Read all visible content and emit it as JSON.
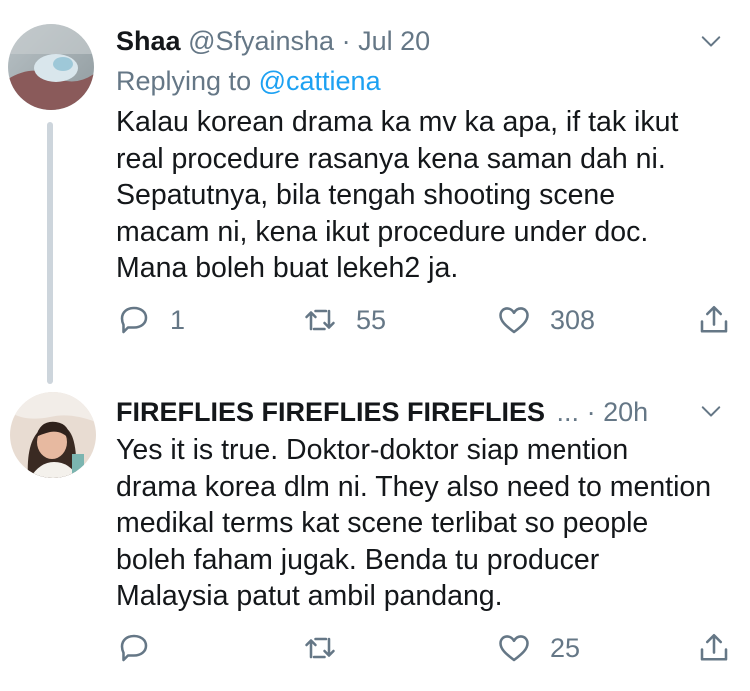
{
  "tweets": [
    {
      "name": "Shaa",
      "handle": "@Sfyainsha",
      "separator": "·",
      "time": "Jul 20",
      "replying_prefix": "Replying to",
      "replying_to": "@cattiena",
      "body_lines": [
        "Kalau korean drama ka mv ka apa, if tak ikut",
        "real procedure rasanya kena saman dah ni.",
        "Sepatutnya, bila tengah shooting scene",
        "macam ni, kena ikut procedure under doc.",
        "Mana boleh buat lekeh2 ja."
      ],
      "replies": "1",
      "retweets": "55",
      "likes": "308"
    },
    {
      "name": "FIREFLIES FIREFLIES FIREFLIES",
      "ellipsis": "...",
      "separator": "·",
      "time": "20h",
      "body_lines": [
        "Yes it is true. Doktor-doktor siap mention",
        "drama korea dlm ni. They also need to mention",
        "medikal terms kat scene terlibat so people",
        "boleh faham jugak. Benda tu producer",
        "Malaysia patut ambil pandang."
      ],
      "replies": "",
      "retweets": "",
      "likes": "25"
    }
  ],
  "icons": {
    "reply": "reply-icon",
    "retweet": "retweet-icon",
    "like": "heart-icon",
    "share": "share-icon",
    "menu": "chevron-down-icon"
  },
  "colors": {
    "text": "#14171a",
    "muted": "#657786",
    "link": "#1da1f2",
    "thread_line": "#cdd5dc"
  }
}
